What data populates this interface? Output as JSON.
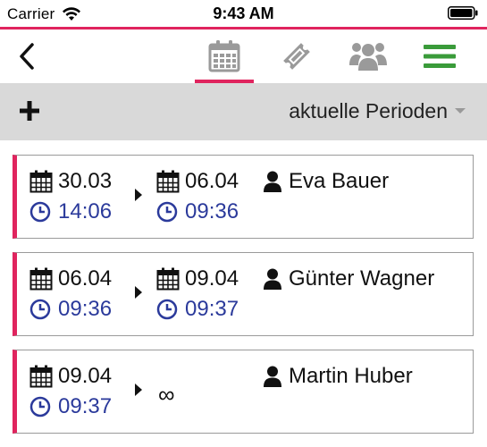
{
  "status_bar": {
    "carrier": "Carrier",
    "time": "9:43 AM"
  },
  "nav": {
    "tabs": [
      {
        "icon": "calendar-icon",
        "active": true
      },
      {
        "icon": "ticket-icon",
        "active": false
      },
      {
        "icon": "group-icon",
        "active": false
      },
      {
        "icon": "menu-icon",
        "active": false
      }
    ]
  },
  "toolbar": {
    "add_label": "+",
    "period_label": "aktuelle Perioden"
  },
  "periods": [
    {
      "start_date": "30.03",
      "start_time": "14:06",
      "end_date": "06.04",
      "end_time": "09:36",
      "person": "Eva Bauer"
    },
    {
      "start_date": "06.04",
      "start_time": "09:36",
      "end_date": "09.04",
      "end_time": "09:37",
      "person": "Günter Wagner"
    },
    {
      "start_date": "09.04",
      "start_time": "09:37",
      "end_symbol": "∞",
      "person": "Martin Huber"
    }
  ],
  "colors": {
    "accent": "#e0245e",
    "time_text": "#2b3a9b",
    "menu_icon": "#3a9b3a",
    "icon_gray": "#9a9a9a",
    "toolbar_bg": "#d9d9d9"
  }
}
